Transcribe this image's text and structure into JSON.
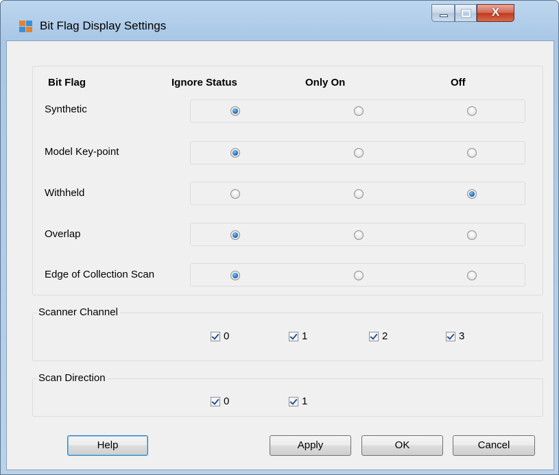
{
  "window": {
    "title": "Bit Flag Display Settings",
    "close_glyph": "X"
  },
  "flags": {
    "columns": [
      "Bit Flag",
      "Ignore Status",
      "Only On",
      "Off"
    ],
    "rows": [
      {
        "label": "Synthetic",
        "selected": "Ignore Status"
      },
      {
        "label": "Model Key-point",
        "selected": "Ignore Status"
      },
      {
        "label": "Withheld",
        "selected": "Off"
      },
      {
        "label": "Overlap",
        "selected": "Ignore Status"
      },
      {
        "label": "Edge of Collection Scan",
        "selected": "Ignore Status"
      }
    ]
  },
  "scanner_channel": {
    "title": "Scanner Channel",
    "options": [
      {
        "label": "0",
        "checked": true
      },
      {
        "label": "1",
        "checked": true
      },
      {
        "label": "2",
        "checked": true
      },
      {
        "label": "3",
        "checked": true
      }
    ]
  },
  "scan_direction": {
    "title": "Scan Direction",
    "options": [
      {
        "label": "0",
        "checked": true
      },
      {
        "label": "1",
        "checked": true
      }
    ]
  },
  "buttons": {
    "help": "Help",
    "apply": "Apply",
    "ok": "OK",
    "cancel": "Cancel"
  },
  "colors": {
    "radio_selected": "#1e6fc0",
    "close_button": "#c0391f",
    "dialog_background": "#f0f0f0"
  }
}
